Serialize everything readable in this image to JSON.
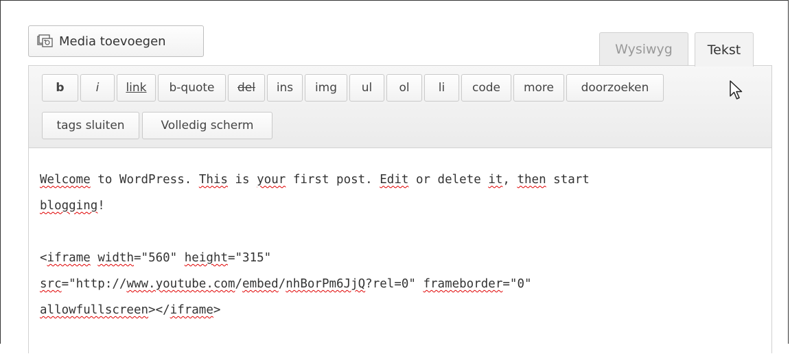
{
  "media_button": {
    "label": "Media toevoegen",
    "icon": "media-camera-icon"
  },
  "tabs": [
    {
      "label": "Wysiwyg",
      "active": false
    },
    {
      "label": "Tekst",
      "active": true
    }
  ],
  "toolbar": {
    "buttons": [
      {
        "label": "b"
      },
      {
        "label": "i"
      },
      {
        "label": "link"
      },
      {
        "label": "b-quote"
      },
      {
        "label": "del"
      },
      {
        "label": "ins"
      },
      {
        "label": "img"
      },
      {
        "label": "ul"
      },
      {
        "label": "ol"
      },
      {
        "label": "li"
      },
      {
        "label": "code"
      },
      {
        "label": "more"
      },
      {
        "label": "doorzoeken"
      },
      {
        "label": "tags sluiten"
      },
      {
        "label": "Volledig scherm"
      }
    ]
  },
  "editor": {
    "lines": [
      [
        {
          "text": "Welcome",
          "spell": true
        },
        {
          "text": " to WordPress. "
        },
        {
          "text": "This",
          "spell": true
        },
        {
          "text": " is "
        },
        {
          "text": "your",
          "spell": true
        },
        {
          "text": " first post. "
        },
        {
          "text": "Edit",
          "spell": true
        },
        {
          "text": " or delete "
        },
        {
          "text": "it",
          "spell": true
        },
        {
          "text": ", "
        },
        {
          "text": "then",
          "spell": true
        },
        {
          "text": " start"
        }
      ],
      [
        {
          "text": "blogging",
          "spell": true
        },
        {
          "text": "!"
        }
      ],
      [],
      [
        {
          "text": "<"
        },
        {
          "text": "iframe",
          "spell": true
        },
        {
          "text": " "
        },
        {
          "text": "width",
          "spell": true
        },
        {
          "text": "=\"560\" "
        },
        {
          "text": "height",
          "spell": true
        },
        {
          "text": "=\"315\""
        }
      ],
      [
        {
          "text": "src",
          "spell": true
        },
        {
          "text": "=\"http://"
        },
        {
          "text": "www.youtube.com",
          "spell": true
        },
        {
          "text": "/"
        },
        {
          "text": "embed",
          "spell": true
        },
        {
          "text": "/"
        },
        {
          "text": "nhBorPm6JjQ",
          "spell": true
        },
        {
          "text": "?rel=0\" "
        },
        {
          "text": "frameborder",
          "spell": true
        },
        {
          "text": "=\"0\""
        }
      ],
      [
        {
          "text": "allowfullscreen",
          "spell": true
        },
        {
          "text": "></"
        },
        {
          "text": "iframe",
          "spell": true
        },
        {
          "text": ">"
        }
      ]
    ]
  }
}
